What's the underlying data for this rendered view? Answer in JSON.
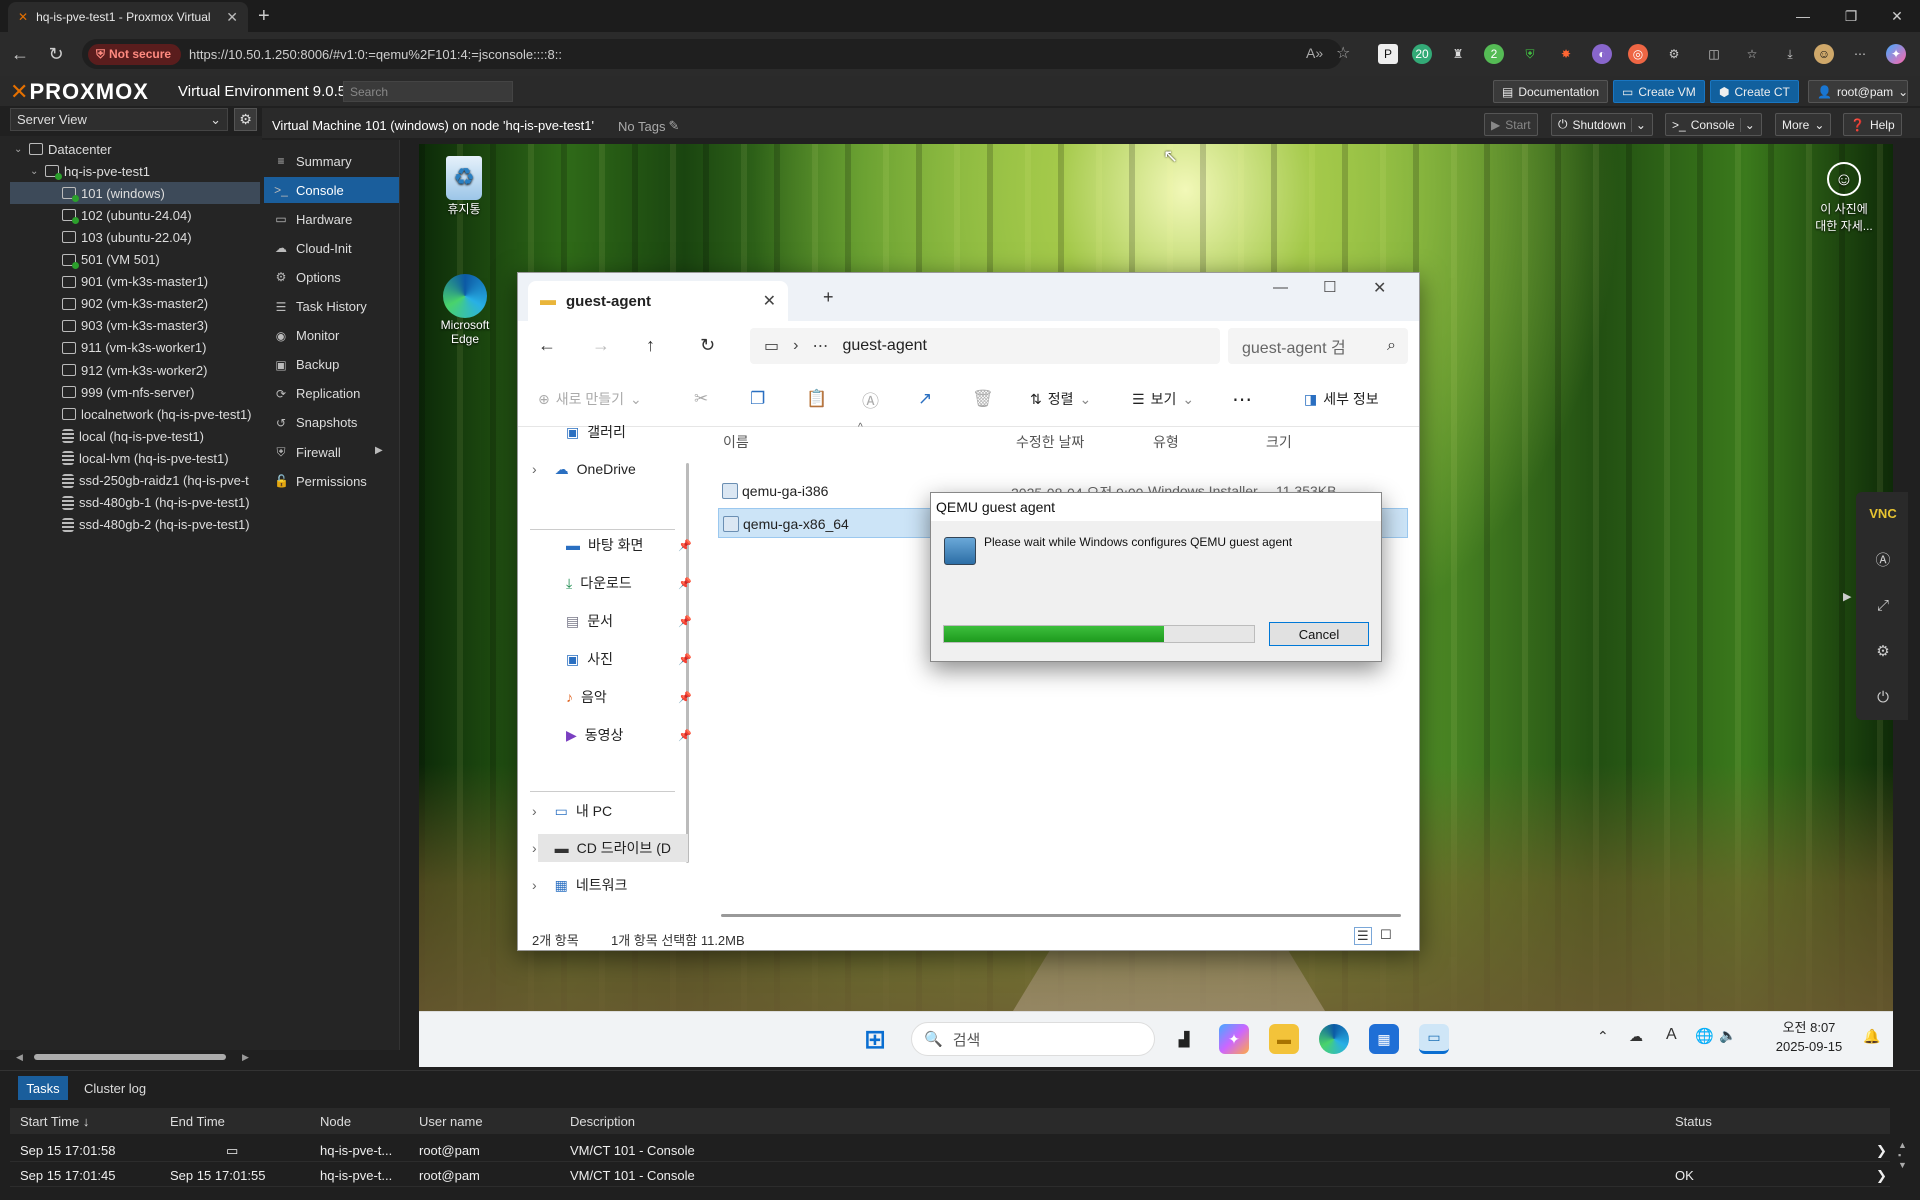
{
  "browser": {
    "tab_title": "hq-is-pve-test1 - Proxmox Virtual",
    "not_secure": "Not secure",
    "url": "https://10.50.1.250:8006/#v1:0:=qemu%2F101:4:=jsconsole::::8::",
    "ext_badge1": "20",
    "ext_badge2": "2"
  },
  "pve": {
    "logo": "PROXMOX",
    "version": "Virtual Environment 9.0.5",
    "search_placeholder": "Search",
    "header_buttons": {
      "docs": "Documentation",
      "create_vm": "Create VM",
      "create_ct": "Create CT",
      "user": "root@pam"
    },
    "server_view": "Server View",
    "tree": [
      {
        "label": "Datacenter",
        "kind": "dc"
      },
      {
        "label": "hq-is-pve-test1",
        "kind": "node"
      },
      {
        "label": "101 (windows)",
        "kind": "vm-run",
        "selected": true
      },
      {
        "label": "102 (ubuntu-24.04)",
        "kind": "vm-run"
      },
      {
        "label": "103 (ubuntu-22.04)",
        "kind": "vm"
      },
      {
        "label": "501 (VM 501)",
        "kind": "vm-run"
      },
      {
        "label": "901 (vm-k3s-master1)",
        "kind": "vm"
      },
      {
        "label": "902 (vm-k3s-master2)",
        "kind": "vm"
      },
      {
        "label": "903 (vm-k3s-master3)",
        "kind": "vm"
      },
      {
        "label": "911 (vm-k3s-worker1)",
        "kind": "vm"
      },
      {
        "label": "912 (vm-k3s-worker2)",
        "kind": "vm"
      },
      {
        "label": "999 (vm-nfs-server)",
        "kind": "vm"
      },
      {
        "label": "localnetwork (hq-is-pve-test1)",
        "kind": "net"
      },
      {
        "label": "local (hq-is-pve-test1)",
        "kind": "db"
      },
      {
        "label": "local-lvm (hq-is-pve-test1)",
        "kind": "db"
      },
      {
        "label": "ssd-250gb-raidz1 (hq-is-pve-t",
        "kind": "db"
      },
      {
        "label": "ssd-480gb-1 (hq-is-pve-test1)",
        "kind": "db"
      },
      {
        "label": "ssd-480gb-2 (hq-is-pve-test1)",
        "kind": "db"
      }
    ],
    "vm_title": "Virtual Machine 101 (windows) on node 'hq-is-pve-test1'",
    "no_tags": "No Tags",
    "vm_buttons": {
      "start": "Start",
      "shutdown": "Shutdown",
      "console": "Console",
      "more": "More",
      "help": "Help"
    },
    "vm_menu": [
      {
        "label": "Summary",
        "icon": "≡"
      },
      {
        "label": "Console",
        "icon": ">_",
        "selected": true
      },
      {
        "label": "Hardware",
        "icon": "▭"
      },
      {
        "label": "Cloud-Init",
        "icon": "☁"
      },
      {
        "label": "Options",
        "icon": "⚙"
      },
      {
        "label": "Task History",
        "icon": "☰"
      },
      {
        "label": "Monitor",
        "icon": "◉"
      },
      {
        "label": "Backup",
        "icon": "▣"
      },
      {
        "label": "Replication",
        "icon": "⟳"
      },
      {
        "label": "Snapshots",
        "icon": "↺"
      },
      {
        "label": "Firewall",
        "icon": "⛨"
      },
      {
        "label": "Permissions",
        "icon": "🔓"
      }
    ]
  },
  "guest": {
    "desktop_icons": {
      "recycle": "휴지통",
      "edge_line1": "Microsoft",
      "edge_line2": "Edge",
      "photo_line1": "이 사진에",
      "photo_line2": "대한 자세..."
    },
    "explorer": {
      "tab_title": "guest-agent",
      "path": "guest-agent",
      "search": "guest-agent 검",
      "toolbar": {
        "new": "새로 만들기",
        "sort": "정렬",
        "view": "보기",
        "details": "세부 정보"
      },
      "nav": [
        {
          "label": "갤러리",
          "pinned": false
        },
        {
          "label": "OneDrive",
          "pinned": false
        },
        {
          "label": "바탕 화면",
          "pinned": true
        },
        {
          "label": "다운로드",
          "pinned": true
        },
        {
          "label": "문서",
          "pinned": true
        },
        {
          "label": "사진",
          "pinned": true
        },
        {
          "label": "음악",
          "pinned": true
        },
        {
          "label": "동영상",
          "pinned": true
        },
        {
          "label": "내 PC",
          "pinned": false
        },
        {
          "label": "CD 드라이브 (D",
          "pinned": false
        },
        {
          "label": "네트워크",
          "pinned": false
        }
      ],
      "columns": {
        "name": "이름",
        "modified": "수정한 날짜",
        "type": "유형",
        "size": "크기"
      },
      "files": [
        {
          "name": "qemu-ga-i386",
          "modified": "2025-08-04 오전 9:00",
          "type": "Windows Installer...",
          "size": "11,353KB"
        },
        {
          "name": "qemu-ga-x86_64",
          "modified": "",
          "type": "",
          "size": "KB",
          "selected": true
        }
      ],
      "status_items": "2개 항목",
      "status_selected": "1개 항목 선택함 11.2MB"
    },
    "dialog": {
      "title": "QEMU guest agent",
      "message": "Please wait while Windows configures QEMU guest agent",
      "progress": 0.71,
      "cancel": "Cancel"
    },
    "taskbar": {
      "search": "검색",
      "time": "오전 8:07",
      "date": "2025-09-15"
    }
  },
  "tasks": {
    "tabs": {
      "tasks": "Tasks",
      "cluster_log": "Cluster log"
    },
    "headers": {
      "start": "Start Time ↓",
      "end": "End Time",
      "node": "Node",
      "user": "User name",
      "desc": "Description",
      "status": "Status"
    },
    "rows": [
      {
        "start": "Sep 15 17:01:58",
        "end": "",
        "node": "hq-is-pve-t...",
        "user": "root@pam",
        "desc": "VM/CT 101 - Console",
        "status": ""
      },
      {
        "start": "Sep 15 17:01:45",
        "end": "Sep 15 17:01:55",
        "node": "hq-is-pve-t...",
        "user": "root@pam",
        "desc": "VM/CT 101 - Console",
        "status": "OK"
      }
    ]
  }
}
